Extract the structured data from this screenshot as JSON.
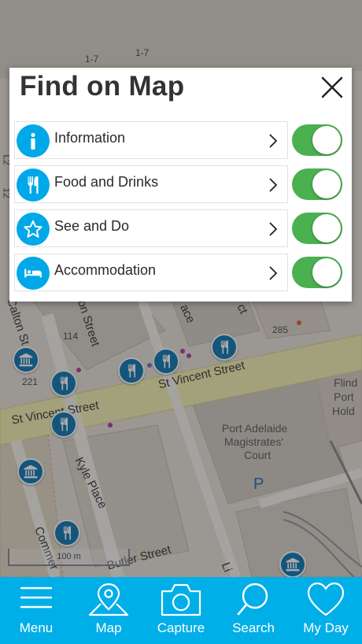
{
  "map": {
    "streets": [
      "St Vincent Street",
      "St Vincent Street",
      "Kyle Place",
      "Butler Street",
      "Calton St",
      "on Street",
      "ace",
      "Commer",
      "Li",
      "ct"
    ],
    "place_labels": [
      "Port Adelaide",
      "Magistrates'",
      "Court",
      "Flind",
      "Port",
      "Hold"
    ],
    "house_numbers": [
      "1-7",
      "1-7",
      "114",
      "221",
      "285",
      "L2",
      "12"
    ],
    "parking_label": "P",
    "scale_label": "100 m"
  },
  "dialog": {
    "title": "Find on Map",
    "rows": [
      {
        "label": "Information",
        "icon": "info-icon",
        "enabled": true
      },
      {
        "label": "Food and Drinks",
        "icon": "fork-knife-icon",
        "enabled": true
      },
      {
        "label": "See and Do",
        "icon": "star-icon",
        "enabled": true
      },
      {
        "label": "Accommodation",
        "icon": "bed-icon",
        "enabled": true
      }
    ]
  },
  "tabbar": {
    "tabs": [
      {
        "label": "Menu",
        "icon": "hamburger-menu-icon"
      },
      {
        "label": "Map",
        "icon": "map-pin-icon"
      },
      {
        "label": "Capture",
        "icon": "camera-icon"
      },
      {
        "label": "Search",
        "icon": "search-icon"
      },
      {
        "label": "My Day",
        "icon": "heart-icon"
      }
    ]
  },
  "colors": {
    "accent": "#00aee8",
    "pin": "#1e7fb8",
    "toggle_on": "#4bb050",
    "dialog_title": "#333333"
  }
}
